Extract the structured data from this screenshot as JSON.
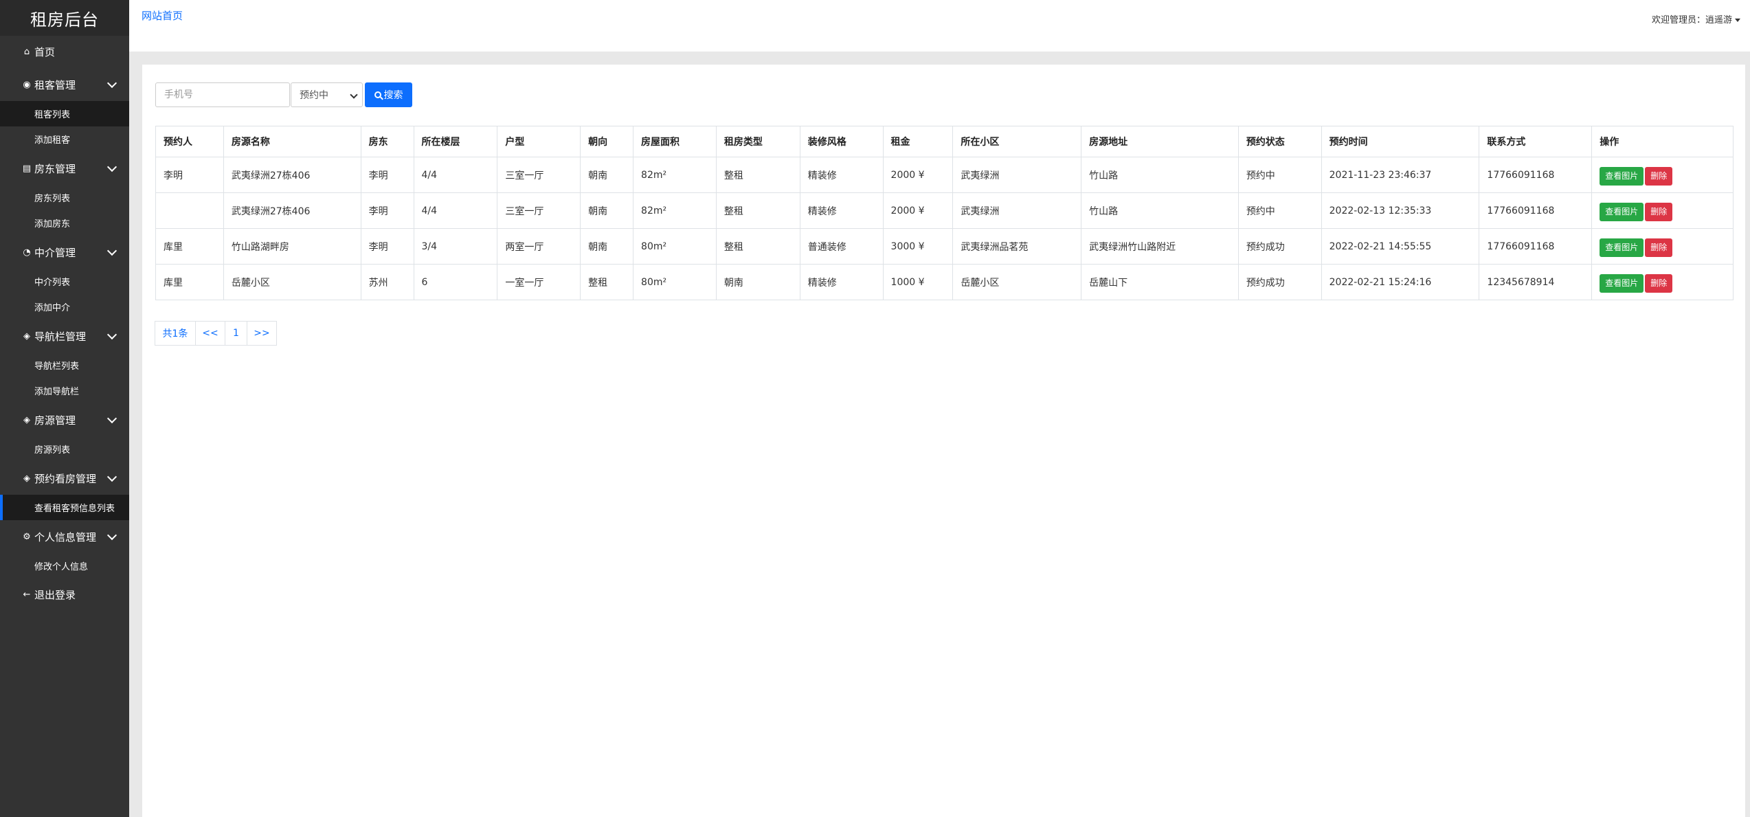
{
  "brand": "租房后台",
  "sidebar": {
    "home": "首页",
    "groups": [
      {
        "label": "租客管理",
        "items": [
          "租客列表",
          "添加租客"
        ]
      },
      {
        "label": "房东管理",
        "items": [
          "房东列表",
          "添加房东"
        ]
      },
      {
        "label": "中介管理",
        "items": [
          "中介列表",
          "添加中介"
        ]
      },
      {
        "label": "导航栏管理",
        "items": [
          "导航栏列表",
          "添加导航栏"
        ]
      },
      {
        "label": "房源管理",
        "items": [
          "房源列表"
        ]
      },
      {
        "label": "预约看房管理",
        "items": [
          "查看租客预信息列表"
        ]
      },
      {
        "label": "个人信息管理",
        "items": [
          "修改个人信息"
        ]
      }
    ],
    "logout": "退出登录"
  },
  "topbar": {
    "site_home": "网站首页",
    "welcome": "欢迎管理员：逍遥游"
  },
  "search": {
    "phone_placeholder": "手机号",
    "status_selected": "预约中",
    "button": "搜索"
  },
  "table": {
    "headers": [
      "预约人",
      "房源名称",
      "房东",
      "所在楼层",
      "户型",
      "朝向",
      "房屋面积",
      "租房类型",
      "装修风格",
      "租金",
      "所在小区",
      "房源地址",
      "预约状态",
      "预约时间",
      "联系方式",
      "操作"
    ],
    "rows": [
      [
        "李明",
        "武夷绿洲27栋406",
        "李明",
        "4/4",
        "三室一厅",
        "朝南",
        "82m²",
        "整租",
        "精装修",
        "2000 ¥",
        "武夷绿洲",
        "竹山路",
        "预约中",
        "2021-11-23 23:46:37",
        "17766091168"
      ],
      [
        "",
        "武夷绿洲27栋406",
        "李明",
        "4/4",
        "三室一厅",
        "朝南",
        "82m²",
        "整租",
        "精装修",
        "2000 ¥",
        "武夷绿洲",
        "竹山路",
        "预约中",
        "2022-02-13 12:35:33",
        "17766091168"
      ],
      [
        "库里",
        "竹山路湖畔房",
        "李明",
        "3/4",
        "两室一厅",
        "朝南",
        "80m²",
        "整租",
        "普通装修",
        "3000 ¥",
        "武夷绿洲品茗苑",
        "武夷绿洲竹山路附近",
        "预约成功",
        "2022-02-21 14:55:55",
        "17766091168"
      ],
      [
        "库里",
        "岳麓小区",
        "苏州",
        "6",
        "一室一厅",
        "整租",
        "80m²",
        "朝南",
        "精装修",
        "1000 ¥",
        "岳麓小区",
        "岳麓山下",
        "预约成功",
        "2022-02-21 15:24:16",
        "12345678914"
      ]
    ],
    "view_label": "查看图片",
    "delete_label": "删除"
  },
  "pagination": {
    "total": "共1条",
    "prev": "<<",
    "page": "1",
    "next": ">>"
  },
  "colors": {
    "sidebar_bg": "#333333",
    "accent": "#0d6efd",
    "pending": "#0000cc",
    "success": "#228b22",
    "view_btn": "#28a745",
    "delete_btn": "#dc3545"
  }
}
